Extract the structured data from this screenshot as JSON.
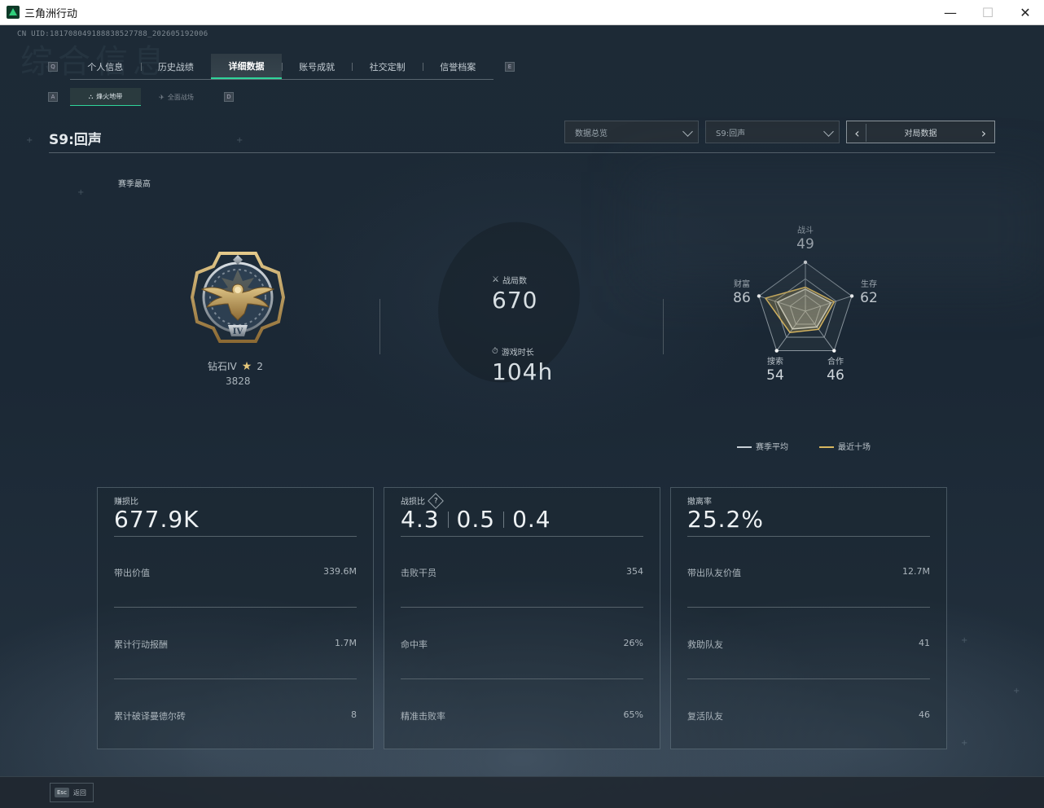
{
  "window": {
    "title": "三角洲行动",
    "minimize": "—",
    "maximize": "☐",
    "close": "✕"
  },
  "uid": "CN UID:181708049188838527788_202605192006",
  "bg_title": "综合信息",
  "tabs": {
    "left_key": "Q",
    "right_key": "E",
    "items": [
      {
        "label": "个人信息"
      },
      {
        "label": "历史战绩"
      },
      {
        "label": "详细数据",
        "active": true
      },
      {
        "label": "账号成就"
      },
      {
        "label": "社交定制"
      },
      {
        "label": "信誉档案"
      }
    ]
  },
  "subtabs": {
    "left_key": "A",
    "right_key": "D",
    "items": [
      {
        "label": "烽火地带",
        "active": true
      },
      {
        "label": "全面战场"
      }
    ]
  },
  "season_title": "S9:回声",
  "filters": {
    "overview": "数据总览",
    "season": "S9:回声",
    "match_data": "对局数据"
  },
  "season_best": "赛季最高",
  "rank": {
    "name": "钻石IV",
    "stars": "2",
    "points": "3828",
    "tier_numeral": "IV"
  },
  "stats": {
    "matches_label": "战局数",
    "matches_value": "670",
    "playtime_label": "游戏时长",
    "playtime_value": "104h"
  },
  "radar": {
    "axes": [
      {
        "name": "战斗",
        "value": 49
      },
      {
        "name": "生存",
        "value": 62
      },
      {
        "name": "合作",
        "value": 46
      },
      {
        "name": "搜索",
        "value": 54
      },
      {
        "name": "财富",
        "value": 86
      }
    ],
    "recent_ten": [
      49,
      62,
      46,
      54,
      86
    ],
    "season_avg": [
      45,
      55,
      40,
      45,
      60
    ],
    "colors": {
      "season_avg": "#c8d0d6",
      "recent": "#d8b760"
    }
  },
  "legend": {
    "season_avg": "赛季平均",
    "recent": "最近十场"
  },
  "panels": [
    {
      "label": "赚损比",
      "value": "677.9K",
      "rows": [
        {
          "label": "带出价值",
          "value": "339.6M"
        },
        {
          "label": "累计行动报酬",
          "value": "1.7M"
        },
        {
          "label": "累计破译曼德尔砖",
          "value": "8"
        }
      ]
    },
    {
      "label": "战损比",
      "help": "?",
      "values": [
        "4.3",
        "0.5",
        "0.4"
      ],
      "rows": [
        {
          "label": "击败干员",
          "value": "354"
        },
        {
          "label": "命中率",
          "value": "26%"
        },
        {
          "label": "精准击败率",
          "value": "65%"
        }
      ]
    },
    {
      "label": "撤离率",
      "value": "25.2%",
      "rows": [
        {
          "label": "带出队友价值",
          "value": "12.7M"
        },
        {
          "label": "救助队友",
          "value": "41"
        },
        {
          "label": "复活队友",
          "value": "46"
        }
      ]
    }
  ],
  "footer": {
    "esc_key": "Esc",
    "esc_label": "返回"
  }
}
